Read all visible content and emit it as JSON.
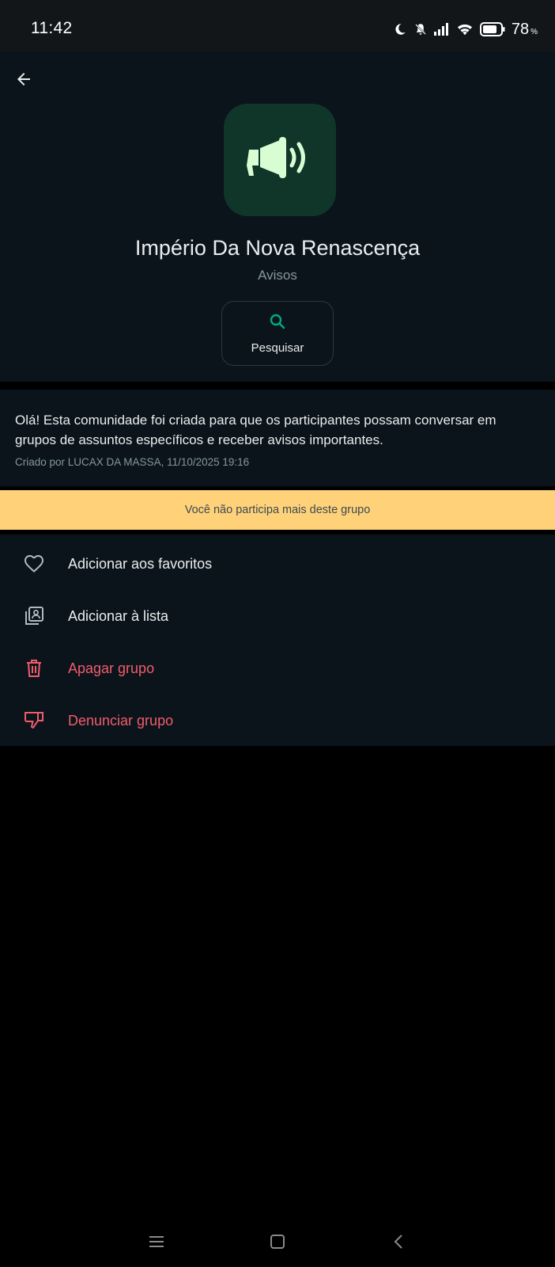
{
  "status_bar": {
    "time": "11:42",
    "battery": "78",
    "battery_unit": "%",
    "icons": [
      "moon-icon",
      "bell-off-icon",
      "signal-icon",
      "wifi-icon",
      "battery-icon"
    ]
  },
  "header": {
    "back_icon": "arrow-left-icon",
    "avatar_icon": "megaphone-icon",
    "group_name": "Império Da Nova Renascença",
    "subtitle": "Avisos",
    "search_label": "Pesquisar"
  },
  "description": {
    "text": "Olá! Esta comunidade foi criada para que os participantes possam conversar em grupos de assuntos específicos e receber avisos importantes.",
    "meta": "Criado por LUCAX DA MASSA, 11/10/2025 19:16"
  },
  "notice": {
    "text": "Você não participa mais deste grupo"
  },
  "actions": [
    {
      "label": "Adicionar aos favoritos",
      "icon": "heart-icon",
      "danger": false
    },
    {
      "label": "Adicionar à lista",
      "icon": "list-icon",
      "danger": false
    },
    {
      "label": "Apagar grupo",
      "icon": "trash-icon",
      "danger": true
    },
    {
      "label": "Denunciar grupo",
      "icon": "thumbs-down-icon",
      "danger": true
    }
  ],
  "nav_bar": {
    "icons": [
      "menu-icon",
      "home-icon",
      "back-icon"
    ]
  },
  "colors": {
    "accent_green": "#00a884",
    "danger_red": "#f15c6d",
    "notice_yellow": "#ffd279",
    "background": "#0b141a"
  }
}
